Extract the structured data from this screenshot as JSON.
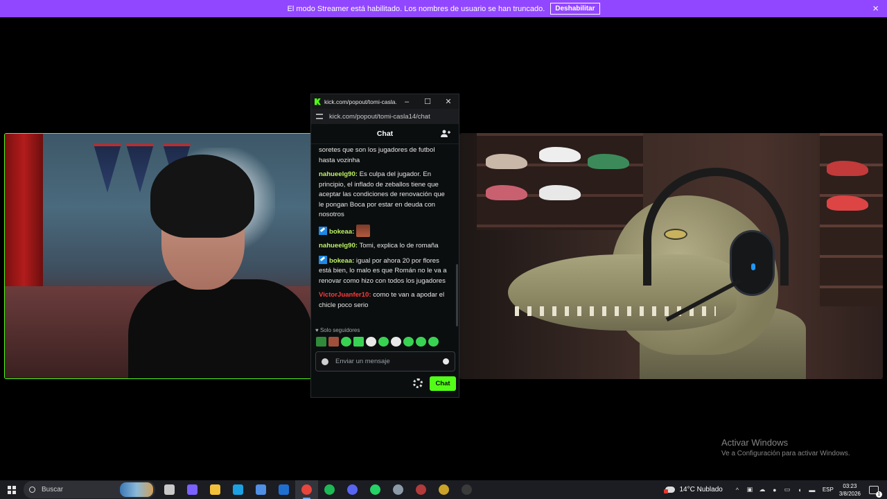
{
  "banner": {
    "message": "El modo Streamer está habilitado. Los nombres de usuario se han truncado.",
    "button_label": "Deshabilitar",
    "close_icon": "×"
  },
  "popout": {
    "tab_title": "kick.com/popout/tomi-casla...",
    "url": "kick.com/popout/tomi-casla14/chat",
    "minimize": "–",
    "maximize": "☐",
    "close": "✕",
    "chat_header": "Chat",
    "messages": [
      {
        "user": "",
        "text": "soretes que son los jugadores de futbol hasta vozinha",
        "color": "#e8e8e8"
      },
      {
        "user": "nahueelg90:",
        "text": " Es culpa del jugador. En principio, el inflado de zeballos tiene que aceptar las condiciones de renovación que le pongan Boca por estar en deuda con nosotros",
        "color": "#bdf364"
      },
      {
        "user": "bokeaa:",
        "text": "",
        "color": "#bdf364",
        "badge": true,
        "emote": true
      },
      {
        "user": "nahueelg90:",
        "text": " Tomi, explica lo de romaña",
        "color": "#bdf364"
      },
      {
        "user": "bokeaa:",
        "text": " igual por ahora 20 por flores está bien, lo malo es que Román no le va a renovar como hizo con todos los jugadores",
        "color": "#bdf364",
        "badge": true
      },
      {
        "user": "VictorJuanfer10:",
        "text": " como te van a apodar el chicle poco serio",
        "color": "#ff3b3b"
      }
    ],
    "followers_label": "♥ Solo seguidores",
    "input_placeholder": "Enviar un mensaje",
    "send_label": "Chat"
  },
  "watermark": {
    "title": "Activar Windows",
    "subtitle": "Ve a Configuración para activar Windows."
  },
  "taskbar": {
    "search_placeholder": "Buscar",
    "apps": [
      {
        "name": "task-view-icon",
        "color": "#c8c8c8"
      },
      {
        "name": "copilot-icon",
        "color": "#7b61ff"
      },
      {
        "name": "file-explorer-icon",
        "color": "#f3c13a"
      },
      {
        "name": "edge-icon",
        "color": "#1ba1e2"
      },
      {
        "name": "store-icon",
        "color": "#4f8fe6"
      },
      {
        "name": "outlook-icon",
        "color": "#1f6fd1"
      },
      {
        "name": "chrome-icon",
        "color": "#e8453c",
        "active": true
      },
      {
        "name": "spotify-icon",
        "color": "#1db954"
      },
      {
        "name": "discord-icon",
        "color": "#5865f2"
      },
      {
        "name": "whatsapp-icon",
        "color": "#25d366"
      },
      {
        "name": "app-icon-1",
        "color": "#8c9aa8"
      },
      {
        "name": "app-icon-2",
        "color": "#b23a3a"
      },
      {
        "name": "app-icon-3",
        "color": "#c9a227"
      },
      {
        "name": "obs-icon",
        "color": "#3a3a3a"
      }
    ],
    "weather": "14°C  Nublado",
    "language": "ESP",
    "time": "03:23",
    "date": "3/8/2026"
  },
  "colors": {
    "banner": "#9147ff",
    "kick_green": "#53fc18"
  }
}
